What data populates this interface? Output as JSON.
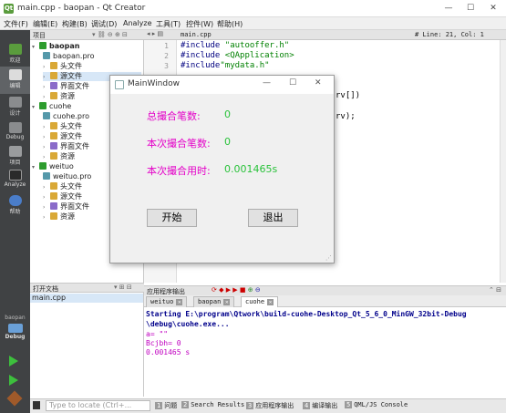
{
  "window": {
    "title": "main.cpp - baopan - Qt Creator",
    "app_icon": "qt-creator-icon"
  },
  "menu": [
    "文件(F)",
    "编辑(E)",
    "构建(B)",
    "调试(D)",
    "Analyze",
    "工具(T)",
    "控件(W)",
    "帮助(H)"
  ],
  "modes": [
    {
      "label": "欢迎"
    },
    {
      "label": "编辑"
    },
    {
      "label": "设计"
    },
    {
      "label": "Debug"
    },
    {
      "label": "项目"
    },
    {
      "label": "Analyze"
    },
    {
      "label": "帮助"
    }
  ],
  "kit": {
    "project": "baopan",
    "config": "Debug"
  },
  "projects_panel": {
    "title": "项目"
  },
  "tree": [
    {
      "label": "baopan",
      "kind": "project",
      "expanded": true
    },
    {
      "label": "baopan.pro",
      "kind": "pro"
    },
    {
      "label": "头文件",
      "kind": "folder"
    },
    {
      "label": "源文件",
      "kind": "folder",
      "selected": true
    },
    {
      "label": "界面文件",
      "kind": "folder"
    },
    {
      "label": "资源",
      "kind": "folder"
    },
    {
      "label": "cuohe",
      "kind": "project",
      "expanded": true
    },
    {
      "label": "cuohe.pro",
      "kind": "pro"
    },
    {
      "label": "头文件",
      "kind": "folder"
    },
    {
      "label": "源文件",
      "kind": "folder"
    },
    {
      "label": "界面文件",
      "kind": "folder"
    },
    {
      "label": "资源",
      "kind": "folder"
    },
    {
      "label": "weituo",
      "kind": "project",
      "expanded": true
    },
    {
      "label": "weituo.pro",
      "kind": "pro"
    },
    {
      "label": "头文件",
      "kind": "folder"
    },
    {
      "label": "源文件",
      "kind": "folder"
    },
    {
      "label": "界面文件",
      "kind": "folder"
    },
    {
      "label": "资源",
      "kind": "folder"
    }
  ],
  "open_docs": {
    "title": "打开文档",
    "items": [
      "main.cpp"
    ]
  },
  "editor": {
    "file_tab": "main.cpp",
    "position": "# Line: 21, Col: 1",
    "line_numbers": [
      "1",
      "2",
      "3"
    ],
    "code": [
      {
        "kw": "#include ",
        "str": "\"autooffer.h\""
      },
      {
        "kw": "#include ",
        "str": "<QApplication>"
      },
      {
        "kw": "#include",
        "str": "\"mydata.h\""
      }
    ],
    "partial": [
      "rv[])",
      "rv);"
    ]
  },
  "output_panel": {
    "title": "应用程序输出",
    "tabs": [
      "weituo",
      "baopan",
      "cuohe"
    ],
    "active_tab": "cuohe",
    "lines": [
      {
        "text": "Starting E:\\program\\Qtwork\\build-cuohe-Desktop_Qt_5_6_0_MinGW_32bit-Debug",
        "color": "#00008b",
        "bold": true
      },
      {
        "text": "\\debug\\cuohe.exe...",
        "color": "#00008b",
        "bold": true
      },
      {
        "text": "a= \"\"",
        "color": "#c000c0",
        "bold": false
      },
      {
        "text": "Bcjbh= 0",
        "color": "#c000c0",
        "bold": false
      },
      {
        "text": "0.001465 s",
        "color": "#c000c0",
        "bold": false
      }
    ]
  },
  "statusbar": {
    "locate_placeholder": "Type to locate (Ctrl+...",
    "items": [
      {
        "n": "1",
        "label": "问题"
      },
      {
        "n": "2",
        "label": "Search Results"
      },
      {
        "n": "3",
        "label": "应用程序输出"
      },
      {
        "n": "4",
        "label": "编译输出"
      },
      {
        "n": "5",
        "label": "QML/JS Console"
      }
    ]
  },
  "mainwindow": {
    "title": "MainWindow",
    "rows": [
      {
        "label": "总撮合笔数:",
        "value": "0"
      },
      {
        "label": "本次撮合笔数:",
        "value": "0"
      },
      {
        "label": "本次撮合用时:",
        "value": "0.001465s"
      }
    ],
    "start_button": "开始",
    "exit_button": "退出"
  },
  "colors": {
    "label": "#e400c8",
    "value": "#29c23a",
    "modebar": "#404244"
  }
}
